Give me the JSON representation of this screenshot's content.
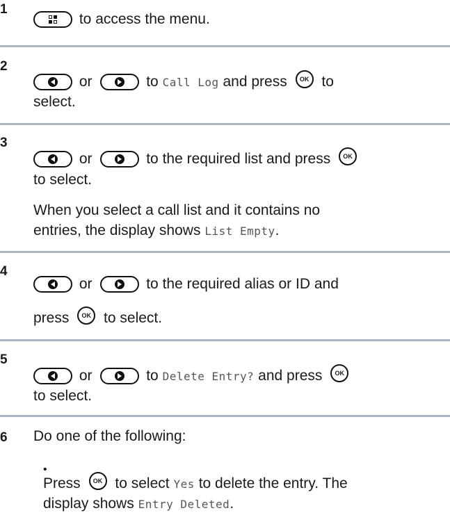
{
  "steps": [
    {
      "number": "1",
      "text_after_menu": "to access the menu."
    },
    {
      "number": "2",
      "or": "or",
      "to": "to",
      "target": "Call Log",
      "and_press": "and press",
      "to_end": "to",
      "line2": "select."
    },
    {
      "number": "3",
      "or": "or",
      "rest": "to the required list and press",
      "line2": "to select.",
      "note_line1": "When you select a call list and it contains no",
      "note_line2_pre": "entries, the display shows",
      "note_code": "List Empty",
      "note_end": "."
    },
    {
      "number": "4",
      "or": "or",
      "rest": "to the required alias or ID and",
      "press": "press",
      "to_select": "to select."
    },
    {
      "number": "5",
      "or": "or",
      "to": "to",
      "target": "Delete Entry?",
      "and_press": "and press",
      "line2": "to select."
    },
    {
      "number": "6",
      "text": "Do one of the following:",
      "bullet": "•",
      "b_press": "Press",
      "b_mid": "to select",
      "b_code": "Yes",
      "b_end": "to delete the entry. The",
      "b_line2_pre": "display shows",
      "b_line2_code": "Entry Deleted",
      "b_line2_end": "."
    }
  ],
  "keys": {
    "ok_label": "OK"
  },
  "icons": [
    "menu-key-icon",
    "left-arrow-key-icon",
    "right-arrow-key-icon",
    "ok-key-icon"
  ]
}
